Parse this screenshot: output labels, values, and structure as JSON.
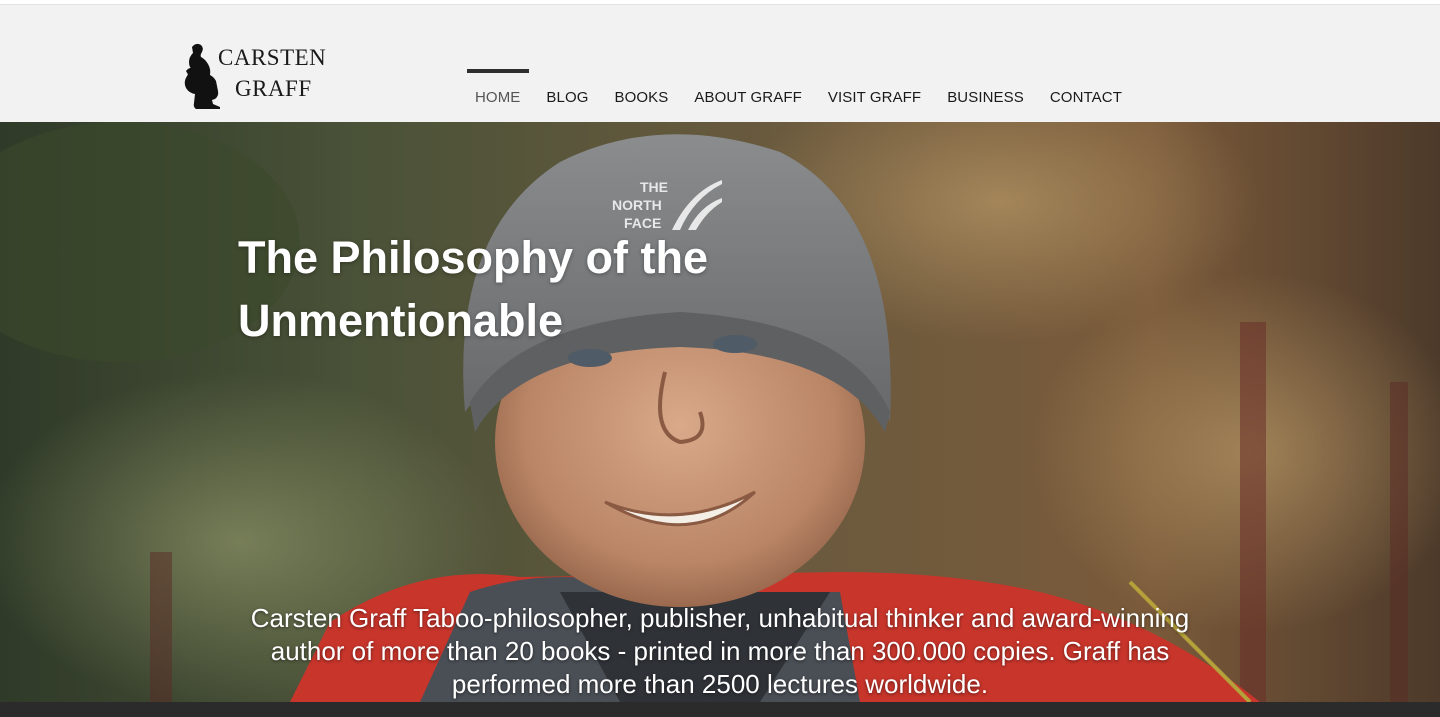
{
  "brand": {
    "line1": "CARSTEN",
    "line2": "GRAFF",
    "logo_icon": "thinker-statue-icon"
  },
  "nav": {
    "items": [
      {
        "label": "HOME",
        "active": true
      },
      {
        "label": "BLOG"
      },
      {
        "label": "BOOKS"
      },
      {
        "label": "ABOUT GRAFF"
      },
      {
        "label": "VISIT GRAFF"
      },
      {
        "label": "BUSINESS"
      },
      {
        "label": "CONTACT"
      }
    ]
  },
  "hero": {
    "title": "The Philosophy of the Unmentionable",
    "description": "Carsten Graff Taboo-philosopher,  publisher, unhabitual thinker and award-winning author of more than 20 books - printed in more than 300.000 copies.  Graff has performed more than 2500 lectures worldwide.",
    "beanie_brand": "THE NORTH FACE"
  },
  "colors": {
    "header_bg": "#f2f2f2",
    "nav_text": "#1a1a1a",
    "active_indicator": "#2e2e2e",
    "hero_text": "#ffffff",
    "jacket_red": "#c8352b",
    "beanie_gray": "#7a7c7e"
  }
}
